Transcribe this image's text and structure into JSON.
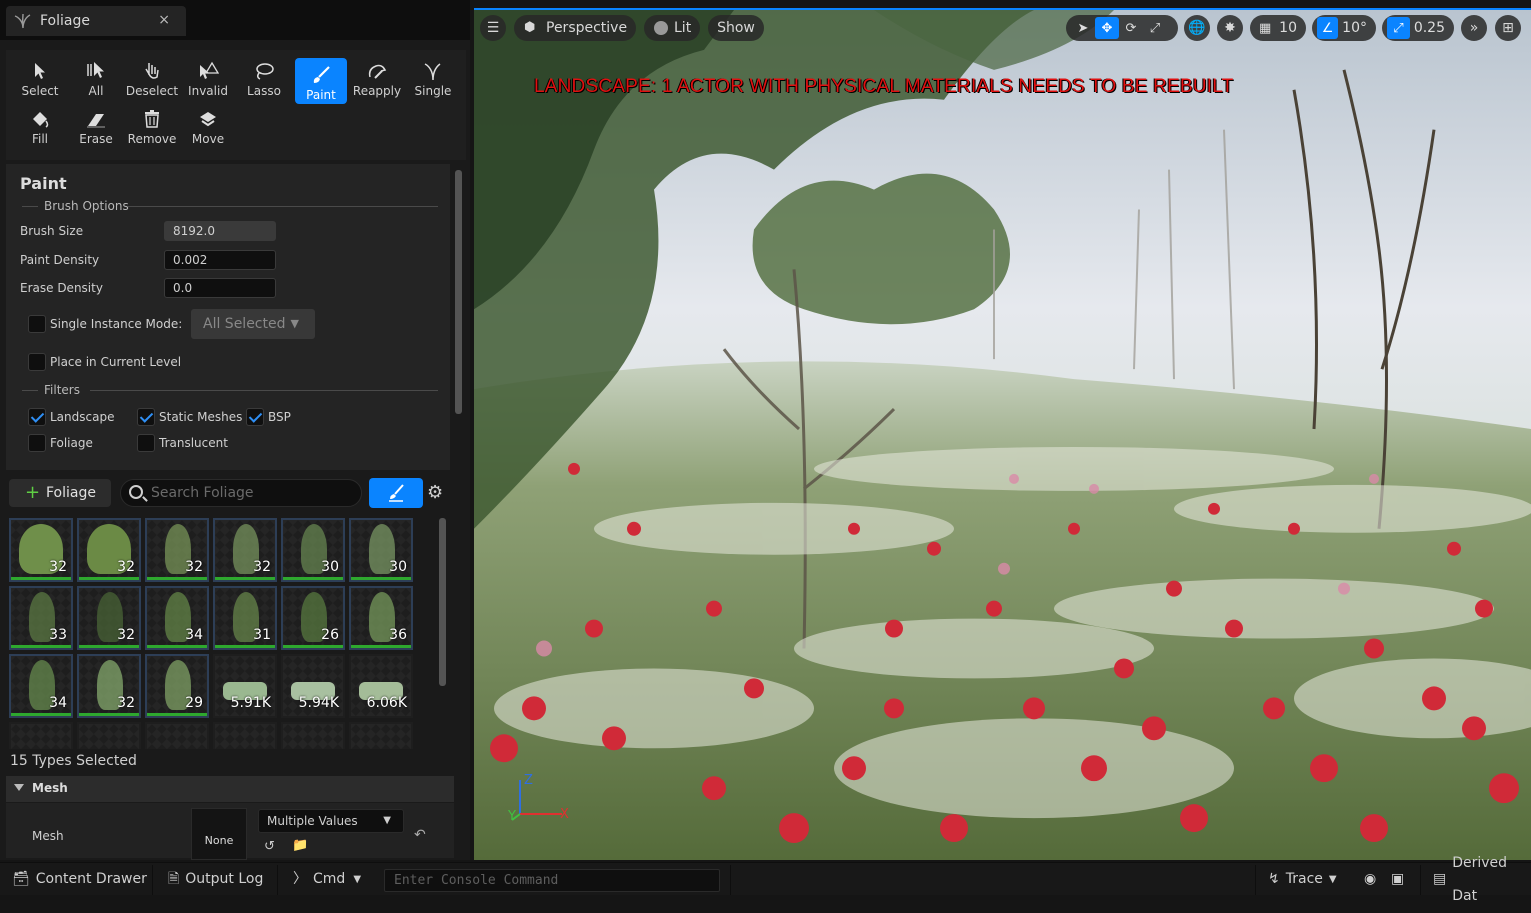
{
  "panel": {
    "tab_title": "Foliage",
    "tab_close": "×",
    "tools_row1": [
      {
        "label": "Select",
        "icon": "cursor-icon"
      },
      {
        "label": "All",
        "icon": "select-all-icon"
      },
      {
        "label": "Deselect",
        "icon": "deselect-icon"
      },
      {
        "label": "Invalid",
        "icon": "invalid-icon"
      },
      {
        "label": "Lasso",
        "icon": "lasso-icon"
      },
      {
        "label": "Paint",
        "icon": "brush-icon",
        "active": true
      },
      {
        "label": "Reapply",
        "icon": "reapply-icon"
      },
      {
        "label": "Single",
        "icon": "single-icon"
      }
    ],
    "tools_row2": [
      {
        "label": "Fill",
        "icon": "fill-icon"
      },
      {
        "label": "Erase",
        "icon": "erase-icon"
      },
      {
        "label": "Remove",
        "icon": "trash-icon"
      },
      {
        "label": "Move",
        "icon": "move-icon"
      }
    ]
  },
  "paint": {
    "title": "Paint",
    "brush_options_label": "Brush Options",
    "brush_size_label": "Brush Size",
    "brush_size_value": "8192.0",
    "paint_density_label": "Paint Density",
    "paint_density_value": "0.002",
    "erase_density_label": "Erase Density",
    "erase_density_value": "0.0",
    "single_instance_label": "Single Instance Mode:",
    "single_instance_dropdown": "All Selected",
    "place_current_level_label": "Place in Current Level",
    "filters_label": "Filters",
    "filters": [
      {
        "label": "Landscape",
        "checked": true
      },
      {
        "label": "Static Meshes",
        "checked": true
      },
      {
        "label": "BSP",
        "checked": true
      },
      {
        "label": "Foliage",
        "checked": false
      },
      {
        "label": "Translucent",
        "checked": false
      }
    ]
  },
  "foliage_list": {
    "add_label": "Foliage",
    "search_placeholder": "Search Foliage",
    "counts": [
      "32",
      "32",
      "32",
      "32",
      "30",
      "30",
      "33",
      "32",
      "34",
      "31",
      "26",
      "36",
      "34",
      "32",
      "29",
      "5.91K",
      "5.94K",
      "6.06K"
    ],
    "types_selected": "15 Types Selected"
  },
  "details": {
    "mesh_section": "Mesh",
    "mesh_label": "Mesh",
    "mesh_thumb": "None",
    "mesh_value": "Multiple Values"
  },
  "viewport": {
    "perspective": "Perspective",
    "lit": "Lit",
    "show": "Show",
    "grid_snap": "10",
    "rot_snap": "10°",
    "scale_snap": "0.25",
    "warning": "LANDSCAPE: 1 ACTOR WITH PHYSICAL MATERIALS NEEDS TO BE REBUILT"
  },
  "statusbar": {
    "content_drawer": "Content Drawer",
    "output_log": "Output Log",
    "cmd": "Cmd",
    "console_placeholder": "Enter Console Command",
    "trace": "Trace",
    "derived": "Derived Dat"
  },
  "colors": {
    "accent": "#0a84ff",
    "warning": "#e01010",
    "thumb_bar": "#2ea82e"
  }
}
